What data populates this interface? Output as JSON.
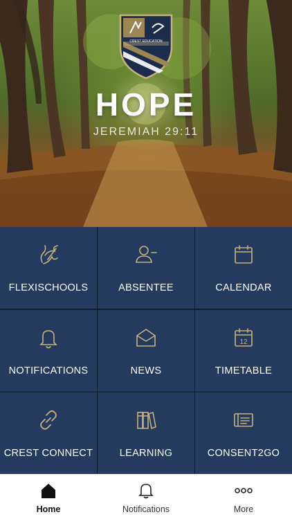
{
  "hero": {
    "title": "HOPE",
    "subtitle": "JEREMIAH 29:11",
    "crest_text": "CREST EDUCATION"
  },
  "tiles": [
    {
      "label": "FLEXISCHOOLS",
      "icon": "flexischools-icon"
    },
    {
      "label": "ABSENTEE",
      "icon": "person-minus-icon"
    },
    {
      "label": "CALENDAR",
      "icon": "calendar-icon"
    },
    {
      "label": "NOTIFICATIONS",
      "icon": "bell-icon"
    },
    {
      "label": "NEWS",
      "icon": "envelope-open-icon"
    },
    {
      "label": "TIMETABLE",
      "icon": "calendar-12-icon",
      "icon_text": "12"
    },
    {
      "label": "CREST CONNECT",
      "icon": "link-icon"
    },
    {
      "label": "LEARNING",
      "icon": "books-icon"
    },
    {
      "label": "CONSENT2GO",
      "icon": "form-icon"
    }
  ],
  "tabbar": {
    "home": "Home",
    "notifications": "Notifications",
    "more": "More",
    "active": "home"
  },
  "colors": {
    "tile_bg": "#243a5f",
    "icon_gold": "#c9b27a",
    "tabbar_bg": "#ffffff"
  }
}
